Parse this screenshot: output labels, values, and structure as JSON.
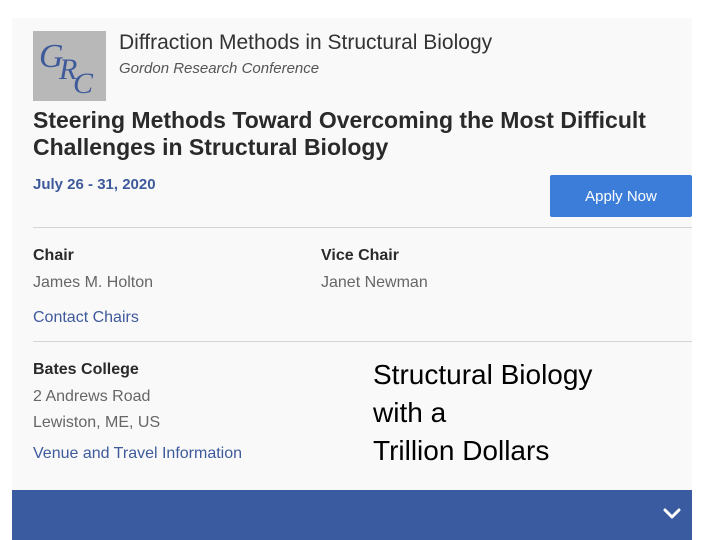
{
  "header": {
    "logo_text": "GRC",
    "conference_name": "Diffraction Methods in Structural Biology",
    "organizer": "Gordon Research Conference"
  },
  "headline": "Steering Methods Toward Overcoming the Most Difficult Challenges in Structural Biology",
  "dates": "July 26 - 31, 2020",
  "apply_button": {
    "label": "Apply Now",
    "color": "#3b7dd8"
  },
  "chairs": {
    "chair_label": "Chair",
    "chair_name": "James M. Holton",
    "vice_chair_label": "Vice Chair",
    "vice_chair_name": "Janet Newman",
    "contact_link": "Contact Chairs"
  },
  "venue": {
    "name": "Bates College",
    "address_line1": "2 Andrews Road",
    "address_line2": "Lewiston, ME, US",
    "info_link": "Venue and Travel Information"
  },
  "overlay_text": "Structural Biology\nwith a\nTrillion Dollars",
  "footer_bar": {
    "color": "#3a5ba0",
    "icon": "chevron-down-icon"
  }
}
